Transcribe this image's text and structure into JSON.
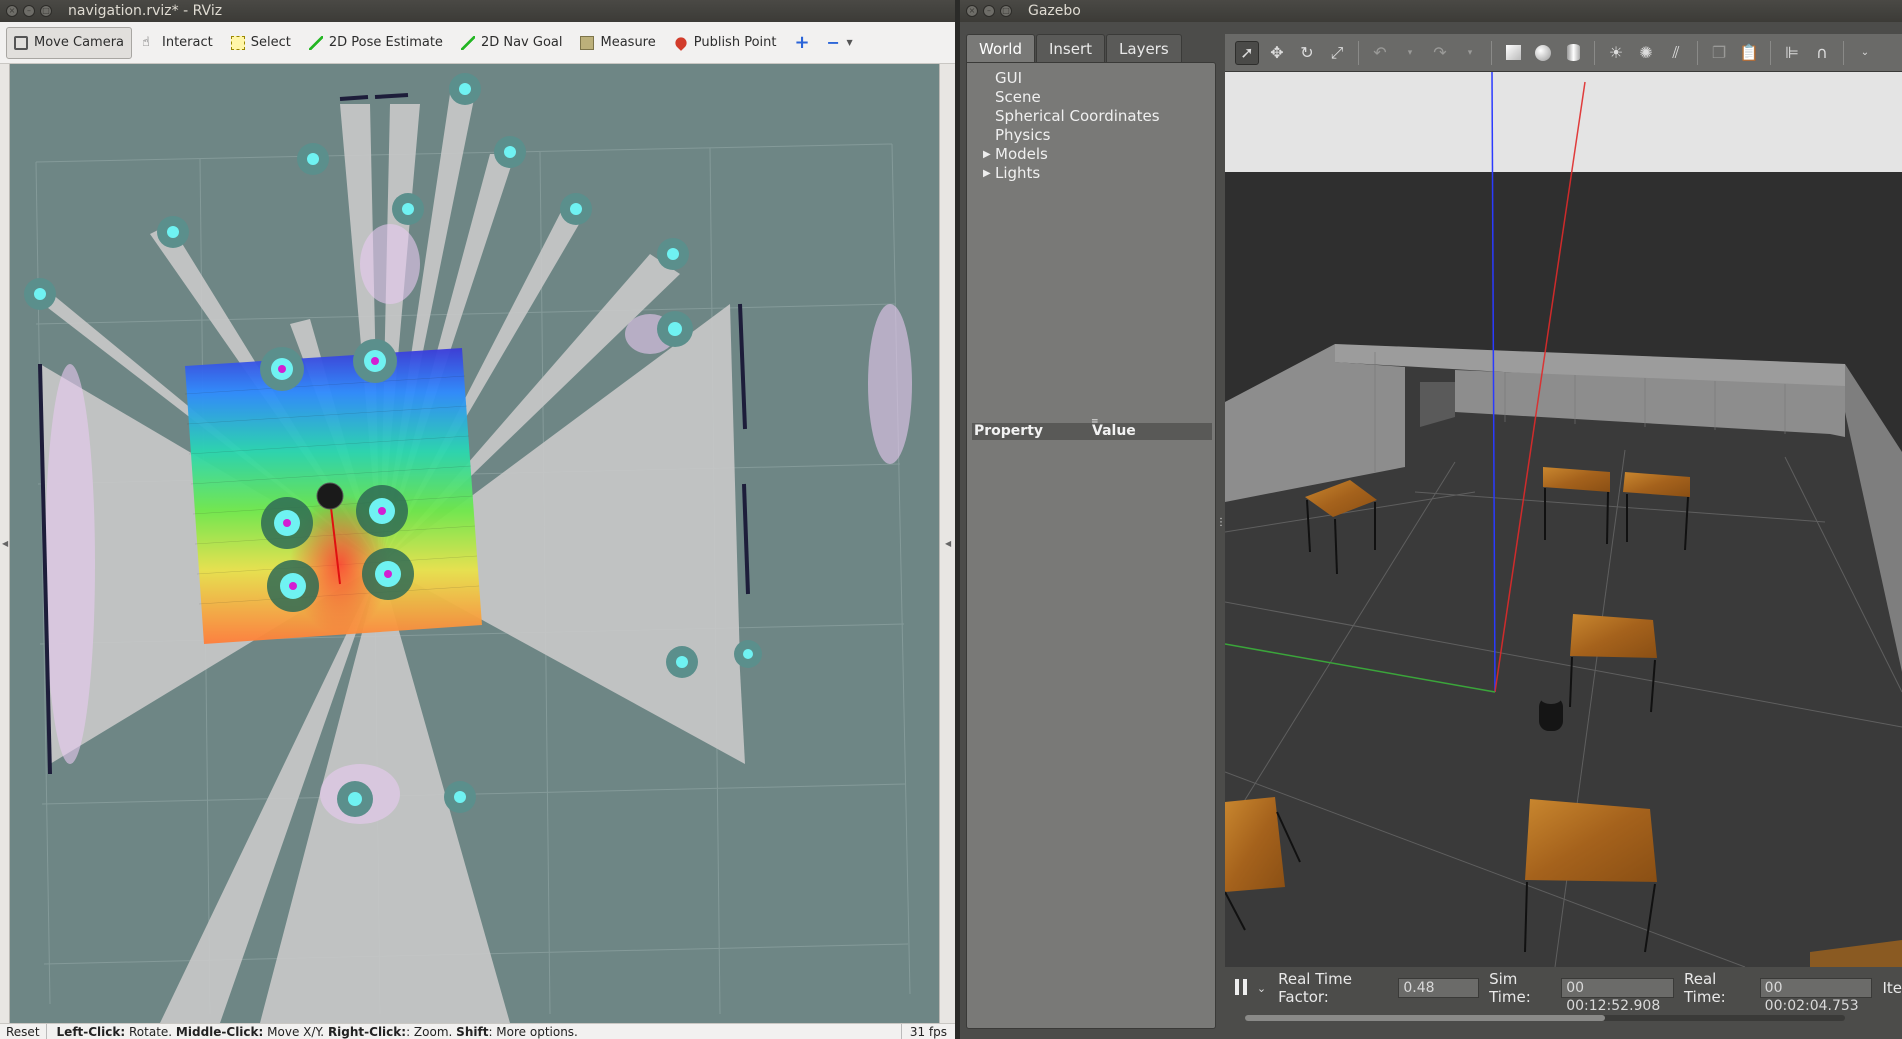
{
  "rviz": {
    "title": "navigation.rviz* - RViz",
    "toolbar": {
      "move_camera": "Move Camera",
      "interact": "Interact",
      "select": "Select",
      "pose_estimate": "2D Pose Estimate",
      "nav_goal": "2D Nav Goal",
      "measure": "Measure",
      "publish_point": "Publish Point"
    },
    "status": {
      "reset": "Reset",
      "left_click_key": "Left-Click:",
      "left_click_val": " Rotate. ",
      "middle_click_key": "Middle-Click:",
      "middle_click_val": " Move X/Y. ",
      "right_click_key": "Right-Click:",
      "right_click_val": ": Zoom. ",
      "shift_key": "Shift",
      "shift_val": ": More options.",
      "fps": "31 fps"
    }
  },
  "gazebo": {
    "title": "Gazebo",
    "tabs": [
      "World",
      "Insert",
      "Layers"
    ],
    "tree": [
      "GUI",
      "Scene",
      "Spherical Coordinates",
      "Physics",
      "Models",
      "Lights"
    ],
    "property_header": "Property",
    "value_header": "Value",
    "bottom": {
      "rtf_label": "Real Time Factor:",
      "rtf_value": "0.48",
      "sim_label": "Sim Time:",
      "sim_value": "00 00:12:52.908",
      "real_label": "Real Time:",
      "real_value": "00 00:02:04.753",
      "iter_label": "Ite"
    }
  }
}
